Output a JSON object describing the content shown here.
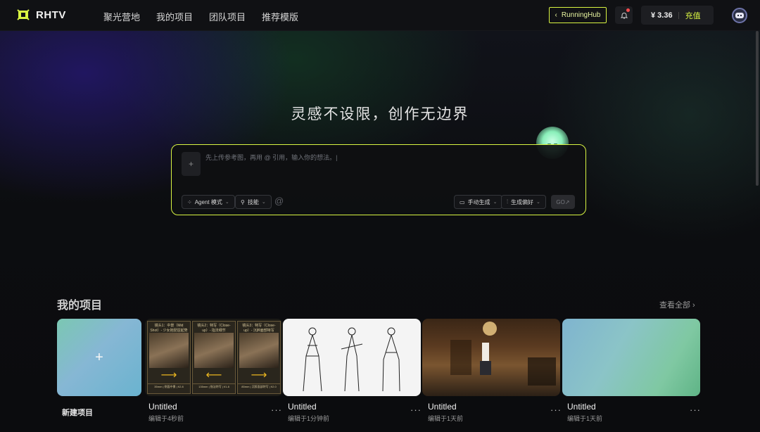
{
  "nav": {
    "brand": "RHTV",
    "menu": [
      "聚光营地",
      "我的项目",
      "团队项目",
      "推荐模版"
    ],
    "runninghub_label": "RunningHub",
    "balance": "¥ 3.36",
    "recharge_label": "充值"
  },
  "hero": {
    "headline": "灵感不设限，创作无边界"
  },
  "prompt": {
    "placeholder": "先上传参考图，再用 @ 引用，输入你的想法。|",
    "agent_mode_label": "Agent 模式",
    "skills_label": "技能",
    "manual_label": "手动生成",
    "pref_label": "生成偏好",
    "go_label": "GO↗"
  },
  "projects": {
    "title": "我的项目",
    "view_all": "查看全部 ›",
    "new_label": "新建项目",
    "items": [
      {
        "title": "Untitled",
        "subtitle": "编辑于4秒前"
      },
      {
        "title": "Untitled",
        "subtitle": "编辑于1分钟前"
      },
      {
        "title": "Untitled",
        "subtitle": "编辑于1天前"
      },
      {
        "title": "Untitled",
        "subtitle": "编辑于1天前"
      }
    ],
    "storyboard": [
      {
        "caption": "镜头1：中景（Mid Shot）- 少女抱琵琶起势",
        "foot": "35mm | 侧面中景 | f/2.8"
      },
      {
        "caption": "镜头2：特写（Close-up）- 指法细节",
        "foot": "135mm | 指法特写 | f/1.8"
      },
      {
        "caption": "镜头3：特写（Close-up）- 沉醉面部特写",
        "foot": "85mm | 沉醉面部特写 | f/2.0"
      }
    ]
  },
  "colors": {
    "accent": "#d9f542",
    "background": "#0b0c0e"
  }
}
